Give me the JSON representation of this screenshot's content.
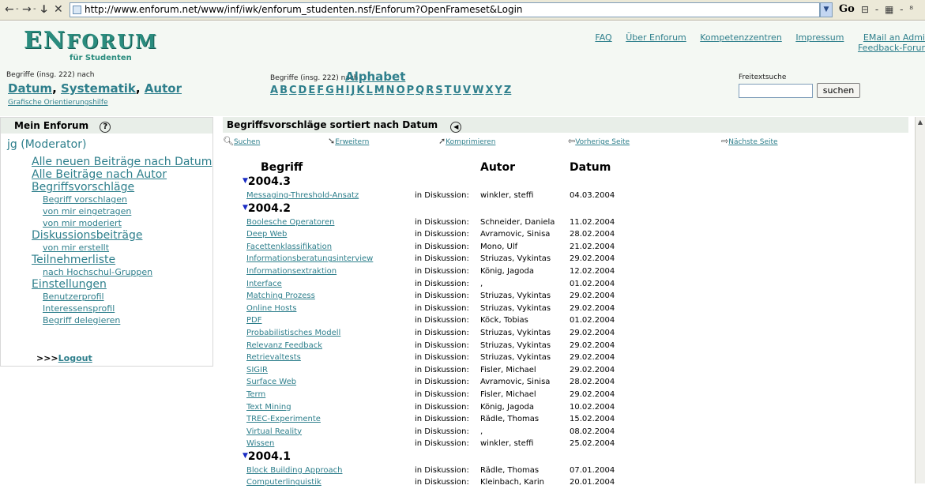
{
  "browser": {
    "nav_glyphs": [
      "←",
      "-",
      "→",
      "-",
      "ↆ",
      "✕"
    ],
    "url": "http://www.enforum.net/www/inf/iwk/enforum_studenten.nsf/Enforum?OpenFrameset&Login",
    "go_label": "Go",
    "extra_glyphs": "⊟ - ▦ - ⁸"
  },
  "header": {
    "logo_prefix": "EN",
    "logo_rest": "FORUM",
    "logo_sub": "für Studenten",
    "links": [
      "FAQ",
      "Über Enforum",
      "Kompetenzzentren",
      "Impressum"
    ],
    "mail_link": "EMail an Admi",
    "feedback_link": "Feedback-Forur",
    "begriffe_label_1": "Begriffe (insg. 222)  nach",
    "sort_links": [
      "Datum",
      "Systematik",
      "Autor"
    ],
    "grafik_link": "Grafische Orientierungshilfe",
    "begriffe_label_2": "Begriffe (insg. 222)  nach",
    "alphabet_link": "Alphabet",
    "letters": [
      "A",
      "B",
      "C",
      "D",
      "E",
      "F",
      "G",
      "H",
      "I",
      "J",
      "K",
      "L",
      "M",
      "N",
      "O",
      "P",
      "Q",
      "R",
      "S",
      "T",
      "U",
      "V",
      "W",
      "X",
      "Y",
      "Z"
    ],
    "freitext_label": "Freitextsuche",
    "search_value": "",
    "search_button": "suchen"
  },
  "sidebar": {
    "title": "Mein Enforum",
    "help_glyph": "?",
    "user": "jg (Moderator)",
    "items": [
      {
        "label": "Alle neuen Beiträge nach Datum",
        "level": "big"
      },
      {
        "label": "Alle Beiträge nach Autor",
        "level": "big"
      },
      {
        "label": "Begriffsvorschläge",
        "level": "big"
      },
      {
        "label": "Begriff vorschlagen",
        "level": "small"
      },
      {
        "label": "von mir eingetragen",
        "level": "small"
      },
      {
        "label": "von mir moderiert",
        "level": "small"
      },
      {
        "label": "Diskussionsbeiträge",
        "level": "big"
      },
      {
        "label": "von mir erstellt",
        "level": "small"
      },
      {
        "label": "Teilnehmerliste",
        "level": "big"
      },
      {
        "label": "nach Hochschul-Gruppen",
        "level": "small"
      },
      {
        "label": "Einstellungen",
        "level": "big"
      },
      {
        "label": "Benutzerprofil",
        "level": "small"
      },
      {
        "label": "Interessensprofil",
        "level": "small"
      },
      {
        "label": "Begriff delegieren",
        "level": "small"
      }
    ],
    "logout_prefix": ">>>",
    "logout_label": "Logout"
  },
  "main": {
    "title": "Begriffsvorschläge sortiert nach Datum",
    "back_glyph": "◀",
    "toolbar": [
      "Suchen",
      "Erweitern",
      "Komprimieren",
      "Vorherige Seite",
      "Nächste Seite"
    ],
    "col_begriff": "Begriff",
    "col_autor": "Autor",
    "col_datum": "Datum",
    "groups": [
      {
        "year": "2004.3",
        "rows": [
          {
            "term": "Messaging-Threshold-Ansatz",
            "status": "in Diskussion:",
            "author": "winkler, steffi",
            "date": "04.03.2004"
          }
        ]
      },
      {
        "year": "2004.2",
        "rows": [
          {
            "term": "Boolesche Operatoren",
            "status": "in Diskussion:",
            "author": "Schneider, Daniela",
            "date": "11.02.2004"
          },
          {
            "term": "Deep Web",
            "status": "in Diskussion:",
            "author": "Avramovic, Sinisa",
            "date": "28.02.2004"
          },
          {
            "term": "Facettenklassifikation",
            "status": "in Diskussion:",
            "author": "Mono, Ulf",
            "date": "21.02.2004"
          },
          {
            "term": "Informationsberatungsinterview",
            "status": "in Diskussion:",
            "author": "Striuzas, Vykintas",
            "date": "29.02.2004"
          },
          {
            "term": "Informationsextraktion",
            "status": "in Diskussion:",
            "author": "König, Jagoda",
            "date": "12.02.2004"
          },
          {
            "term": "Interface",
            "status": "in Diskussion:",
            "author": ",",
            "date": "01.02.2004"
          },
          {
            "term": "Matching Prozess",
            "status": "in Diskussion:",
            "author": "Striuzas, Vykintas",
            "date": "29.02.2004"
          },
          {
            "term": "Online Hosts",
            "status": "in Diskussion:",
            "author": "Striuzas, Vykintas",
            "date": "29.02.2004"
          },
          {
            "term": "PDF",
            "status": "in Diskussion:",
            "author": "Köck, Tobias",
            "date": "01.02.2004"
          },
          {
            "term": "Probabilistisches Modell",
            "status": "in Diskussion:",
            "author": "Striuzas, Vykintas",
            "date": "29.02.2004"
          },
          {
            "term": "Relevanz Feedback",
            "status": "in Diskussion:",
            "author": "Striuzas, Vykintas",
            "date": "29.02.2004"
          },
          {
            "term": "Retrievaltests",
            "status": "in Diskussion:",
            "author": "Striuzas, Vykintas",
            "date": "29.02.2004"
          },
          {
            "term": "SIGIR",
            "status": "in Diskussion:",
            "author": "Fisler, Michael",
            "date": "29.02.2004"
          },
          {
            "term": "Surface Web",
            "status": "in Diskussion:",
            "author": "Avramovic, Sinisa",
            "date": "28.02.2004"
          },
          {
            "term": "Term",
            "status": "in Diskussion:",
            "author": "Fisler, Michael",
            "date": "29.02.2004"
          },
          {
            "term": "Text Mining",
            "status": "in Diskussion:",
            "author": "König, Jagoda",
            "date": "10.02.2004"
          },
          {
            "term": "TREC-Experimente",
            "status": "in Diskussion:",
            "author": "Rädle, Thomas",
            "date": "15.02.2004"
          },
          {
            "term": "Virtual Reality",
            "status": "in Diskussion:",
            "author": ",",
            "date": "08.02.2004"
          },
          {
            "term": "Wissen",
            "status": "in Diskussion:",
            "author": "winkler, steffi",
            "date": "25.02.2004"
          }
        ]
      },
      {
        "year": "2004.1",
        "rows": [
          {
            "term": "Block Building Approach",
            "status": "in Diskussion:",
            "author": "Rädle, Thomas",
            "date": "07.01.2004"
          },
          {
            "term": "Computerlinguistik",
            "status": "in Diskussion:",
            "author": "Kleinbach, Karin",
            "date": "20.01.2004"
          }
        ]
      }
    ]
  }
}
